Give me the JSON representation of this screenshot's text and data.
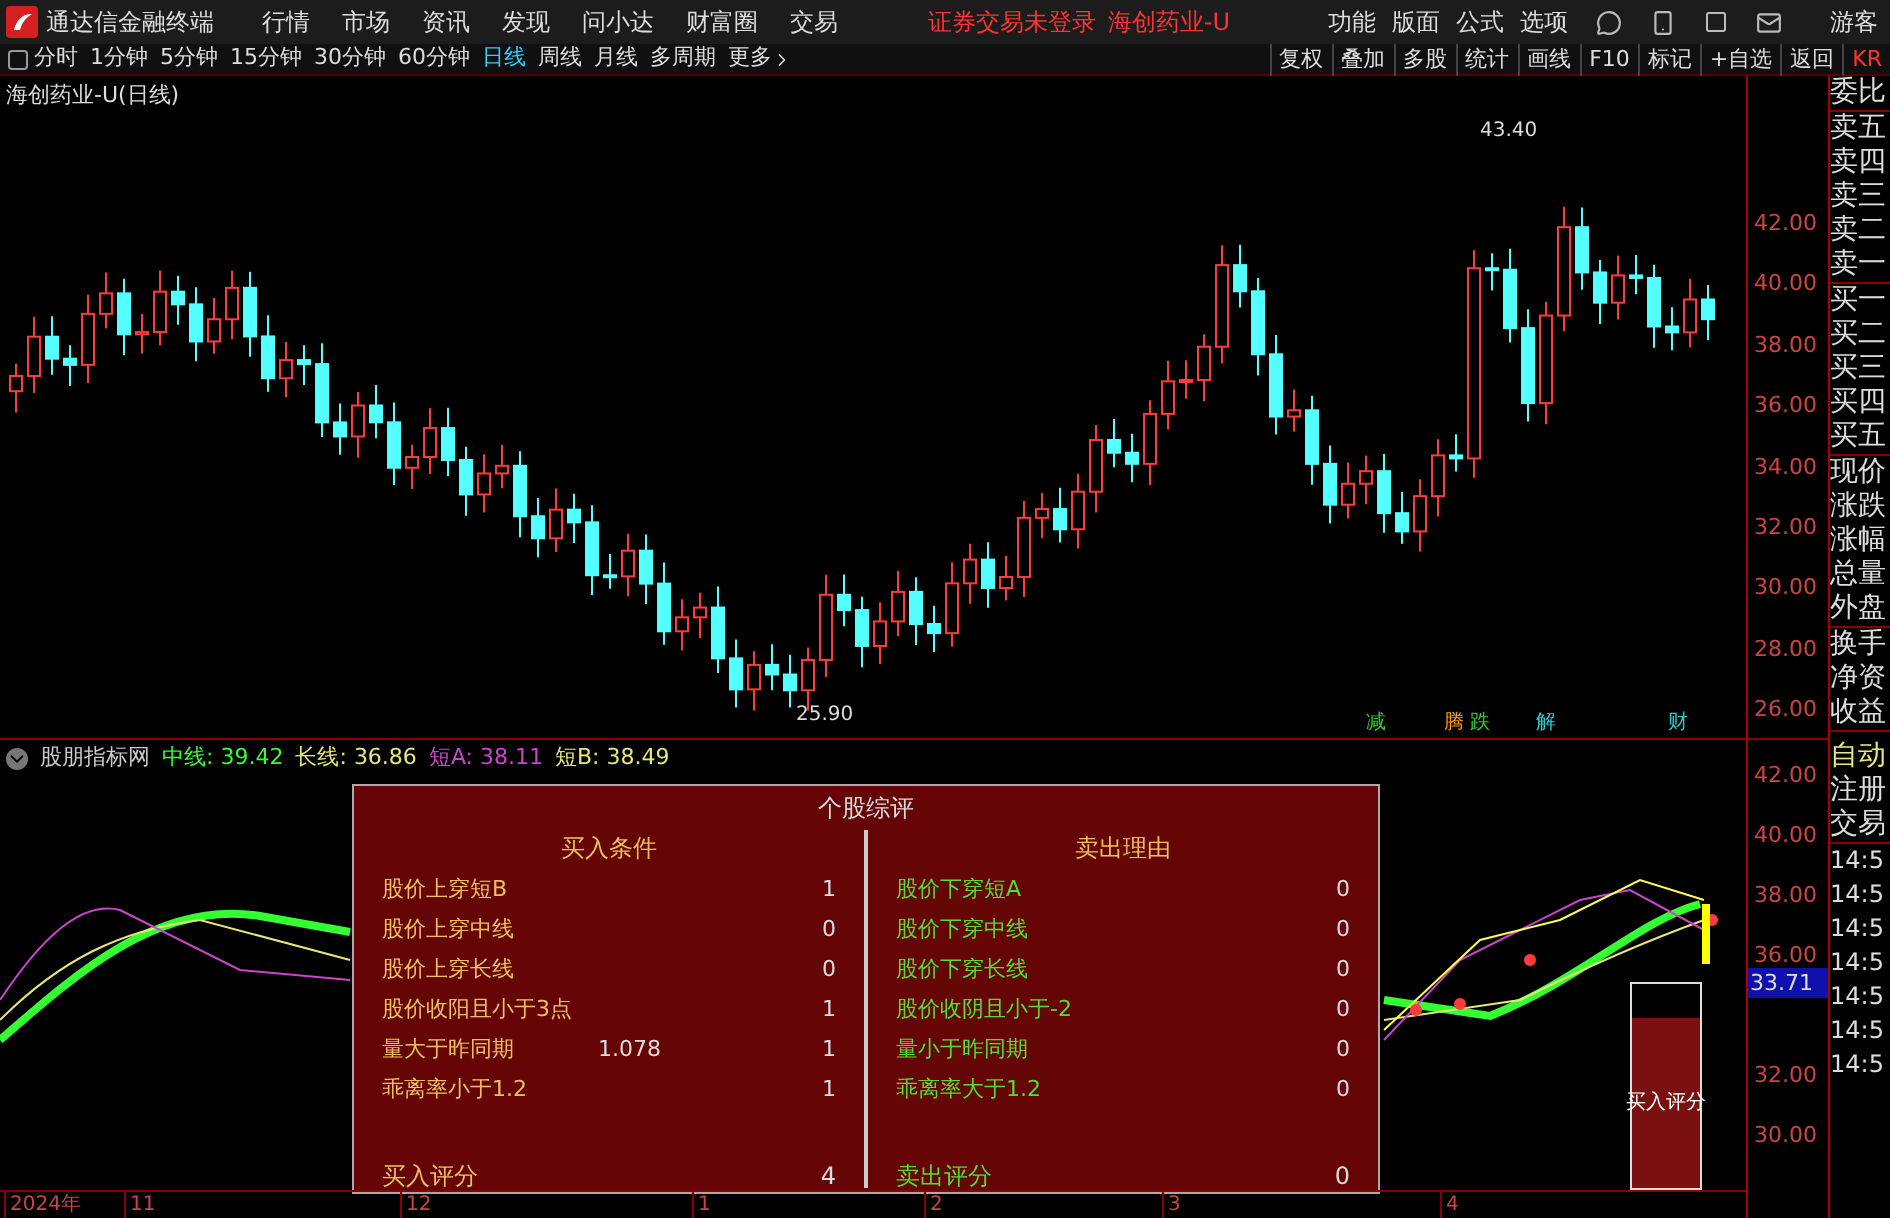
{
  "app": {
    "title": "通达信金融终端",
    "menu": [
      "行情",
      "市场",
      "资讯",
      "发现",
      "问小达",
      "财富圈",
      "交易"
    ],
    "notice": "证券交易未登录",
    "stock": "海创药业-U",
    "right_menu": [
      "功能",
      "版面",
      "公式",
      "选项"
    ],
    "user": "游客"
  },
  "period_tabs": [
    {
      "label": "分时",
      "selected": false
    },
    {
      "label": "1分钟",
      "selected": false
    },
    {
      "label": "5分钟",
      "selected": false
    },
    {
      "label": "15分钟",
      "selected": false
    },
    {
      "label": "30分钟",
      "selected": false
    },
    {
      "label": "60分钟",
      "selected": false
    },
    {
      "label": "日线",
      "selected": true
    },
    {
      "label": "周线",
      "selected": false
    },
    {
      "label": "月线",
      "selected": false
    },
    {
      "label": "多周期",
      "selected": false
    },
    {
      "label": "更多",
      "selected": false
    }
  ],
  "tool_buttons": [
    "复权",
    "叠加",
    "多股",
    "统计",
    "画线",
    "F10",
    "标记",
    "+自选",
    "返回",
    "KR"
  ],
  "main_chart": {
    "title": "海创药业-U(日线)",
    "high_label": "43.40",
    "low_label": "25.90",
    "y_ticks": [
      "42.00",
      "40.00",
      "38.00",
      "36.00",
      "34.00",
      "32.00",
      "30.00",
      "28.00",
      "26.00"
    ],
    "event_marks": [
      {
        "label": "减",
        "color": "#33cc33"
      },
      {
        "label": "腾",
        "color": "#ff9900"
      },
      {
        "label": "跌",
        "color": "#33cc33"
      },
      {
        "label": "解",
        "color": "#33cccc"
      },
      {
        "label": "财",
        "color": "#33cccc"
      }
    ]
  },
  "quote_panel": [
    [
      "委比"
    ],
    [
      "卖五",
      "卖四",
      "卖三",
      "卖二",
      "卖一"
    ],
    [
      "买一",
      "买二",
      "买三",
      "买四",
      "买五"
    ],
    [
      "现价",
      "涨跌",
      "涨幅",
      "总量",
      "外盘"
    ],
    [
      "换手",
      "净资",
      "收益"
    ]
  ],
  "indicator": {
    "name": "股朋指标网",
    "values": [
      {
        "label": "中线:",
        "value": "39.42",
        "color": "#33ff33"
      },
      {
        "label": "长线:",
        "value": "36.86",
        "color": "#e6e67a"
      },
      {
        "label": "短A:",
        "value": "38.11",
        "color": "#cc44cc"
      },
      {
        "label": "短B:",
        "value": "38.49",
        "color": "#e6e67a"
      }
    ],
    "y_ticks": [
      "42.00",
      "40.00",
      "38.00",
      "36.00",
      "32.00",
      "30.00"
    ],
    "current_value": "33.71"
  },
  "trade_panel": {
    "links": [
      "自动",
      "注册",
      "交易"
    ],
    "times": [
      "14:5",
      "14:5",
      "14:5",
      "14:5",
      "14:5",
      "14:5",
      "14:5"
    ]
  },
  "review_dialog": {
    "title": "个股综评",
    "buy": {
      "heading": "买入条件",
      "rows": [
        {
          "label": "股价上穿短B",
          "value": "1"
        },
        {
          "label": "股价上穿中线",
          "value": "0"
        },
        {
          "label": "股价上穿长线",
          "value": "0"
        },
        {
          "label": "股价收阳且小于3点",
          "value": "1"
        },
        {
          "label": "量大于昨同期",
          "extra": "1.078",
          "value": "1"
        },
        {
          "label": "乖离率小于1.2",
          "value": "1"
        }
      ],
      "total_label": "买入评分",
      "total": "4"
    },
    "sell": {
      "heading": "卖出理由",
      "rows": [
        {
          "label": "股价下穿短A",
          "value": "0"
        },
        {
          "label": "股价下穿中线",
          "value": "0"
        },
        {
          "label": "股价下穿长线",
          "value": "0"
        },
        {
          "label": "股价收阴且小于-2",
          "value": "0"
        },
        {
          "label": "量小于昨同期",
          "value": "0"
        },
        {
          "label": "乖离率大于1.2",
          "value": "0"
        }
      ],
      "total_label": "卖出评分",
      "total": "0"
    }
  },
  "score_box": {
    "label": "买入评分",
    "level": 0.83
  },
  "time_axis": [
    "2024年",
    "11",
    "12",
    "1",
    "2",
    "3",
    "4"
  ]
}
